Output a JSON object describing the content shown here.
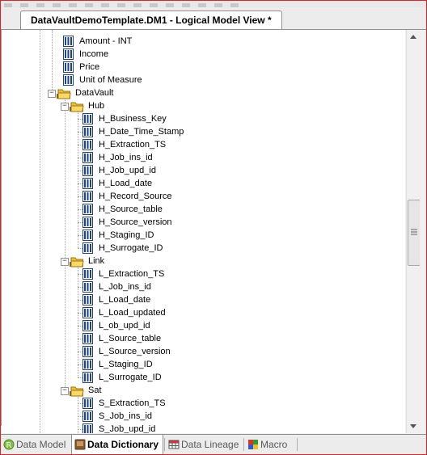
{
  "document_tab": {
    "title": "DataVaultDemoTemplate.DM1 - Logical Model View *"
  },
  "tree": {
    "nodes": [
      {
        "label": "Amount - INT",
        "kind": "column",
        "level": 1
      },
      {
        "label": "Income",
        "kind": "column",
        "level": 1
      },
      {
        "label": "Price",
        "kind": "column",
        "level": 1
      },
      {
        "label": "Unit of Measure",
        "kind": "column",
        "level": 1
      },
      {
        "label": "DataVault",
        "kind": "folder",
        "level": 0,
        "expander": "−"
      },
      {
        "label": "Hub",
        "kind": "folder",
        "level": 1,
        "expander": "−"
      },
      {
        "label": "H_Business_Key",
        "kind": "column",
        "level": 2
      },
      {
        "label": "H_Date_Time_Stamp",
        "kind": "column",
        "level": 2
      },
      {
        "label": "H_Extraction_TS",
        "kind": "column",
        "level": 2
      },
      {
        "label": "H_Job_ins_id",
        "kind": "column",
        "level": 2
      },
      {
        "label": "H_Job_upd_id",
        "kind": "column",
        "level": 2
      },
      {
        "label": "H_Load_date",
        "kind": "column",
        "level": 2
      },
      {
        "label": "H_Record_Source",
        "kind": "column",
        "level": 2
      },
      {
        "label": "H_Source_table",
        "kind": "column",
        "level": 2
      },
      {
        "label": "H_Source_version",
        "kind": "column",
        "level": 2
      },
      {
        "label": "H_Staging_ID",
        "kind": "column",
        "level": 2
      },
      {
        "label": "H_Surrogate_ID",
        "kind": "column",
        "level": 2
      },
      {
        "label": "Link",
        "kind": "folder",
        "level": 1,
        "expander": "−"
      },
      {
        "label": "L_Extraction_TS",
        "kind": "column",
        "level": 2
      },
      {
        "label": "L_Job_ins_id",
        "kind": "column",
        "level": 2
      },
      {
        "label": "L_Load_date",
        "kind": "column",
        "level": 2
      },
      {
        "label": "L_Load_updated",
        "kind": "column",
        "level": 2
      },
      {
        "label": "L_ob_upd_id",
        "kind": "column",
        "level": 2
      },
      {
        "label": "L_Source_table",
        "kind": "column",
        "level": 2
      },
      {
        "label": "L_Source_version",
        "kind": "column",
        "level": 2
      },
      {
        "label": "L_Staging_ID",
        "kind": "column",
        "level": 2
      },
      {
        "label": "L_Surrogate_ID",
        "kind": "column",
        "level": 2
      },
      {
        "label": "Sat",
        "kind": "folder",
        "level": 1,
        "expander": "−"
      },
      {
        "label": "S_Extraction_TS",
        "kind": "column",
        "level": 2
      },
      {
        "label": "S_Job_ins_id",
        "kind": "column",
        "level": 2
      },
      {
        "label": "S_Job_upd_id",
        "kind": "column",
        "level": 2
      }
    ]
  },
  "scrollbar": {
    "position_fraction": 0.56,
    "grip_icon": "grip-lines-icon"
  },
  "bottom_tabs": [
    {
      "label": "Data Model",
      "icon": "data-model-icon",
      "active": false
    },
    {
      "label": "Data Dictionary",
      "icon": "data-dictionary-icon",
      "active": true
    },
    {
      "label": "Data Lineage",
      "icon": "data-lineage-icon",
      "active": false
    },
    {
      "label": "Macro",
      "icon": "macro-icon",
      "active": false
    }
  ],
  "colors": {
    "column_icon": "#1f3f8f",
    "folder": "#f2c12e",
    "border_accent": "#dd2222",
    "active_tab": "#ffffff"
  }
}
